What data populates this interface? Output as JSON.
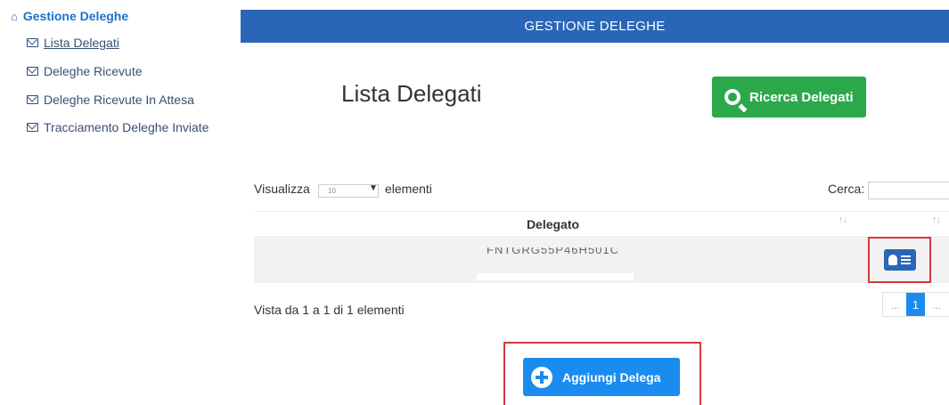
{
  "sidebar": {
    "title": "Gestione Deleghe",
    "items": [
      {
        "label": "Lista Delegati"
      },
      {
        "label": "Deleghe Ricevute"
      },
      {
        "label": "Deleghe Ricevute In Attesa"
      },
      {
        "label": "Tracciamento Deleghe Inviate"
      }
    ]
  },
  "header": {
    "title": "GESTIONE DELEGHE"
  },
  "main": {
    "page_title": "Lista Delegati",
    "search_button_label": "Ricerca Delegati",
    "add_button_label": "Aggiungi Delega"
  },
  "table": {
    "length_label": "Visualizza",
    "length_value": "10",
    "length_suffix": "elementi",
    "search_label": "Cerca:",
    "columns": [
      "Delegato",
      ""
    ],
    "rows": [
      {
        "delegato": "FNTGRG55P46H501C"
      }
    ],
    "info": "Vista da 1 a 1 di 1 elementi",
    "pagination": {
      "prev": "...",
      "current": "1",
      "next": "..."
    }
  },
  "colors": {
    "header_bg": "#2a66b8",
    "search_btn": "#2aa84a",
    "add_btn": "#1a8cf0",
    "highlight": "#d83838"
  }
}
